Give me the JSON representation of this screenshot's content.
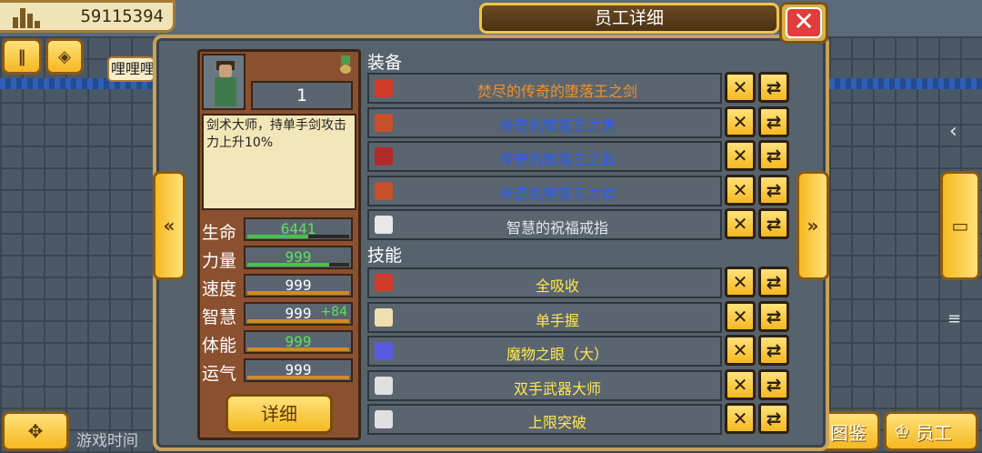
{
  "top": {
    "money": "59115394",
    "chat_text": "哩哩哩"
  },
  "panel": {
    "title": "员工详细",
    "close_label": "✕"
  },
  "character": {
    "level": "1",
    "description": "剑术大师，持单手剑攻击力上升10%",
    "detail_button": "详细",
    "stats": [
      {
        "label": "生命",
        "value": "6441",
        "bonus": "",
        "value_color": "#5ee05e",
        "bar": 0.6,
        "bar_color": "#4cc04c"
      },
      {
        "label": "力量",
        "value": "999",
        "bonus": "",
        "value_color": "#5ee05e",
        "bar": 0.8,
        "bar_color": "#4cc04c"
      },
      {
        "label": "速度",
        "value": "999",
        "bonus": "",
        "value_color": "#ffffff",
        "bar": 1.0,
        "bar_color": "#d08a2a"
      },
      {
        "label": "智慧",
        "value": "999",
        "bonus": "+84",
        "value_color": "#ffffff",
        "bar": 1.0,
        "bar_color": "#d08a2a"
      },
      {
        "label": "体能",
        "value": "999",
        "bonus": "",
        "value_color": "#5ee05e",
        "bar": 1.0,
        "bar_color": "#d08a2a"
      },
      {
        "label": "运气",
        "value": "999",
        "bonus": "",
        "value_color": "#ffffff",
        "bar": 1.0,
        "bar_color": "#d08a2a"
      }
    ]
  },
  "equipment": {
    "heading": "装备",
    "items": [
      {
        "name": "焚尽的传奇的堕落王之剑",
        "color": "#f0902a",
        "icon": "sword-icon",
        "icon_color": "#d23a2a"
      },
      {
        "name": "传奇的堕落王之盾",
        "color": "#2a5ef0",
        "icon": "shield-icon",
        "icon_color": "#c8502a"
      },
      {
        "name": "传奇的堕落王之盔",
        "color": "#2a5ef0",
        "icon": "helmet-icon",
        "icon_color": "#b02a2a"
      },
      {
        "name": "传奇的堕落王之铠",
        "color": "#2a5ef0",
        "icon": "armor-icon",
        "icon_color": "#c8502a"
      },
      {
        "name": "智慧的祝福戒指",
        "color": "#e6e6e6",
        "icon": "ring-icon",
        "icon_color": "#e8e8e8"
      }
    ]
  },
  "skills": {
    "heading": "技能",
    "items": [
      {
        "name": "全吸收",
        "color": "#ffe84a",
        "icon": "absorb-icon",
        "icon_color": "#d23a2a"
      },
      {
        "name": "单手握",
        "color": "#ffe84a",
        "icon": "hand-grip-icon",
        "icon_color": "#f0e0b0"
      },
      {
        "name": "魔物之眼（大）",
        "color": "#ffe84a",
        "icon": "monster-eye-icon",
        "icon_color": "#5a5ae0"
      },
      {
        "name": "双手武器大师",
        "color": "#ffe84a",
        "icon": "two-hand-weapon-icon",
        "icon_color": "#e0e0e0"
      },
      {
        "name": "上限突破",
        "color": "#ffe84a",
        "icon": "limit-break-icon",
        "icon_color": "#e0e0e0"
      }
    ]
  },
  "bottom": {
    "game_time": "游戏时间",
    "encyclopedia": "图鉴",
    "staff": "员工"
  }
}
